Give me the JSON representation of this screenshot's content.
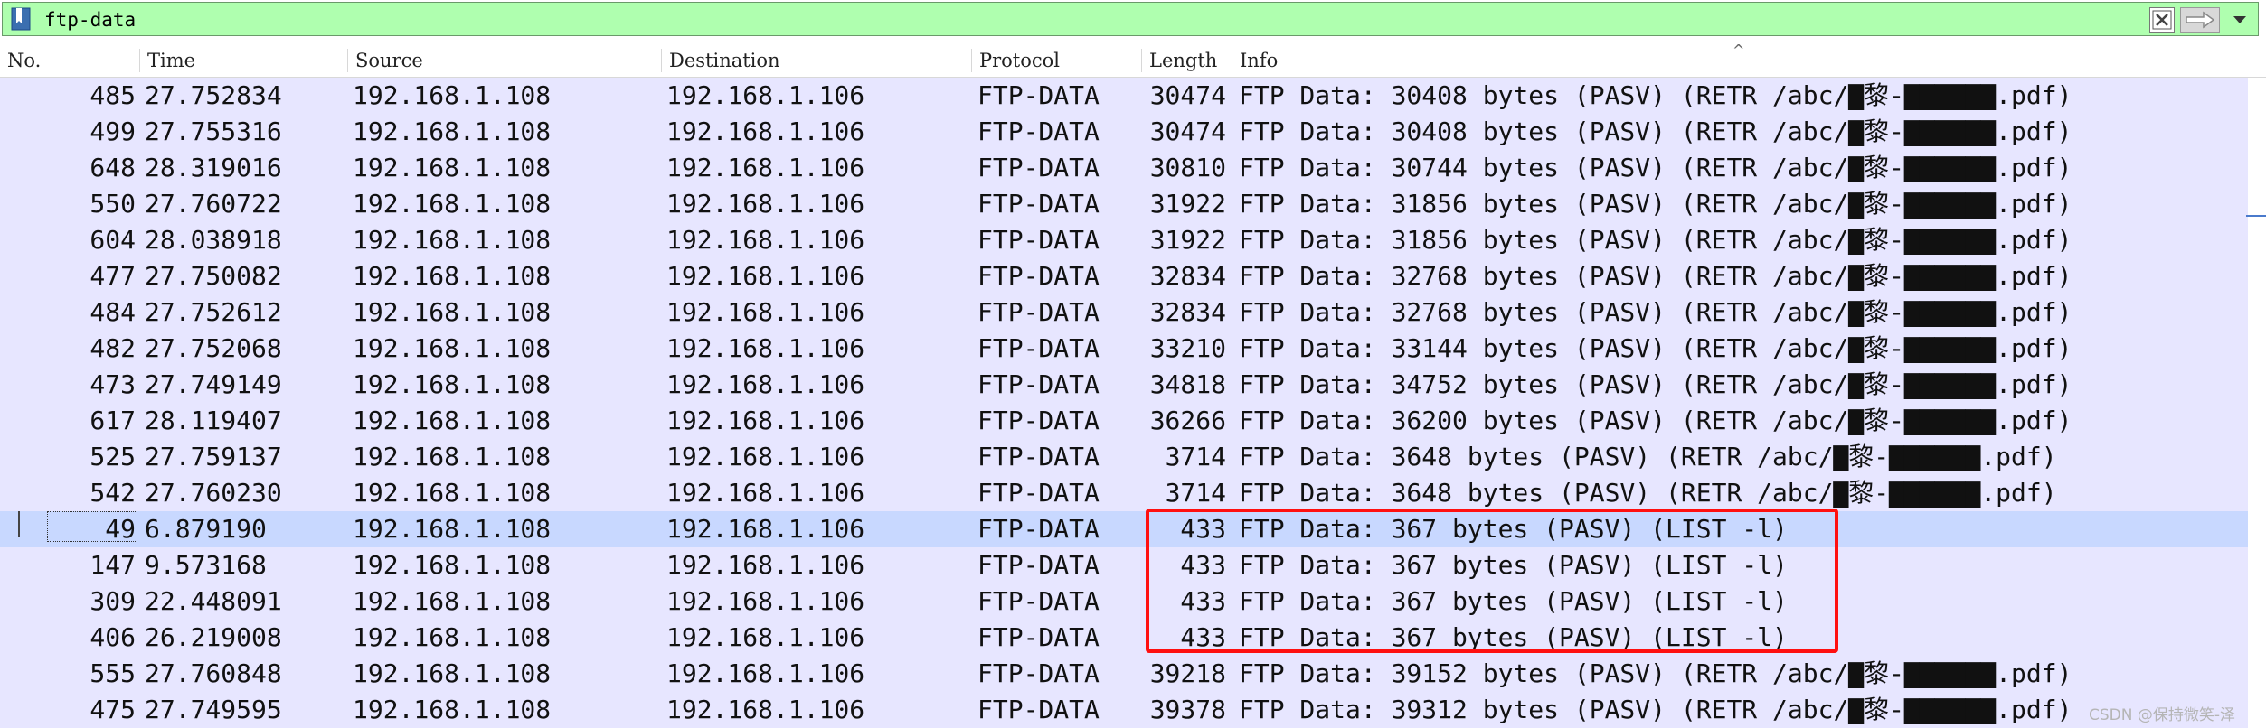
{
  "filter": {
    "value": "ftp-data",
    "bookmark_icon": "bookmark-icon",
    "clear_icon": "clear-x-icon",
    "apply_icon": "arrow-right-icon",
    "dropdown_icon": "chevron-down-icon"
  },
  "columns": {
    "no": "No.",
    "time": "Time",
    "source": "Source",
    "destination": "Destination",
    "protocol": "Protocol",
    "length": "Length",
    "info": "Info"
  },
  "packets": [
    {
      "no": "485",
      "time": "27.752834",
      "source": "192.168.1.108",
      "destination": "192.168.1.106",
      "protocol": "FTP-DATA",
      "length": "30474",
      "info": "FTP Data: 30408 bytes (PASV) (RETR /abc/▇黎-▇▇▇▇▇▇.pdf)"
    },
    {
      "no": "499",
      "time": "27.755316",
      "source": "192.168.1.108",
      "destination": "192.168.1.106",
      "protocol": "FTP-DATA",
      "length": "30474",
      "info": "FTP Data: 30408 bytes (PASV) (RETR /abc/▇黎-▇▇▇▇▇▇.pdf)"
    },
    {
      "no": "648",
      "time": "28.319016",
      "source": "192.168.1.108",
      "destination": "192.168.1.106",
      "protocol": "FTP-DATA",
      "length": "30810",
      "info": "FTP Data: 30744 bytes (PASV) (RETR /abc/▇黎-▇▇▇▇▇▇.pdf)"
    },
    {
      "no": "550",
      "time": "27.760722",
      "source": "192.168.1.108",
      "destination": "192.168.1.106",
      "protocol": "FTP-DATA",
      "length": "31922",
      "info": "FTP Data: 31856 bytes (PASV) (RETR /abc/▇黎-▇▇▇▇▇▇.pdf)"
    },
    {
      "no": "604",
      "time": "28.038918",
      "source": "192.168.1.108",
      "destination": "192.168.1.106",
      "protocol": "FTP-DATA",
      "length": "31922",
      "info": "FTP Data: 31856 bytes (PASV) (RETR /abc/▇黎-▇▇▇▇▇▇.pdf)"
    },
    {
      "no": "477",
      "time": "27.750082",
      "source": "192.168.1.108",
      "destination": "192.168.1.106",
      "protocol": "FTP-DATA",
      "length": "32834",
      "info": "FTP Data: 32768 bytes (PASV) (RETR /abc/▇黎-▇▇▇▇▇▇.pdf)"
    },
    {
      "no": "484",
      "time": "27.752612",
      "source": "192.168.1.108",
      "destination": "192.168.1.106",
      "protocol": "FTP-DATA",
      "length": "32834",
      "info": "FTP Data: 32768 bytes (PASV) (RETR /abc/▇黎-▇▇▇▇▇▇.pdf)"
    },
    {
      "no": "482",
      "time": "27.752068",
      "source": "192.168.1.108",
      "destination": "192.168.1.106",
      "protocol": "FTP-DATA",
      "length": "33210",
      "info": "FTP Data: 33144 bytes (PASV) (RETR /abc/▇黎-▇▇▇▇▇▇.pdf)"
    },
    {
      "no": "473",
      "time": "27.749149",
      "source": "192.168.1.108",
      "destination": "192.168.1.106",
      "protocol": "FTP-DATA",
      "length": "34818",
      "info": "FTP Data: 34752 bytes (PASV) (RETR /abc/▇黎-▇▇▇▇▇▇.pdf)"
    },
    {
      "no": "617",
      "time": "28.119407",
      "source": "192.168.1.108",
      "destination": "192.168.1.106",
      "protocol": "FTP-DATA",
      "length": "36266",
      "info": "FTP Data: 36200 bytes (PASV) (RETR /abc/▇黎-▇▇▇▇▇▇.pdf)"
    },
    {
      "no": "525",
      "time": "27.759137",
      "source": "192.168.1.108",
      "destination": "192.168.1.106",
      "protocol": "FTP-DATA",
      "length": "3714",
      "info": "FTP Data: 3648 bytes (PASV) (RETR /abc/▇黎-▇▇▇▇▇▇.pdf)"
    },
    {
      "no": "542",
      "time": "27.760230",
      "source": "192.168.1.108",
      "destination": "192.168.1.106",
      "protocol": "FTP-DATA",
      "length": "3714",
      "info": "FTP Data: 3648 bytes (PASV) (RETR /abc/▇黎-▇▇▇▇▇▇.pdf)"
    },
    {
      "no": "49",
      "time": "6.879190",
      "source": "192.168.1.108",
      "destination": "192.168.1.106",
      "protocol": "FTP-DATA",
      "length": "433",
      "info": "FTP Data: 367 bytes (PASV) (LIST -l)"
    },
    {
      "no": "147",
      "time": "9.573168",
      "source": "192.168.1.108",
      "destination": "192.168.1.106",
      "protocol": "FTP-DATA",
      "length": "433",
      "info": "FTP Data: 367 bytes (PASV) (LIST -l)"
    },
    {
      "no": "309",
      "time": "22.448091",
      "source": "192.168.1.108",
      "destination": "192.168.1.106",
      "protocol": "FTP-DATA",
      "length": "433",
      "info": "FTP Data: 367 bytes (PASV) (LIST -l)"
    },
    {
      "no": "406",
      "time": "26.219008",
      "source": "192.168.1.108",
      "destination": "192.168.1.106",
      "protocol": "FTP-DATA",
      "length": "433",
      "info": "FTP Data: 367 bytes (PASV) (LIST -l)"
    },
    {
      "no": "555",
      "time": "27.760848",
      "source": "192.168.1.108",
      "destination": "192.168.1.106",
      "protocol": "FTP-DATA",
      "length": "39218",
      "info": "FTP Data: 39152 bytes (PASV) (RETR /abc/▇黎-▇▇▇▇▇▇.pdf)"
    },
    {
      "no": "475",
      "time": "27.749595",
      "source": "192.168.1.108",
      "destination": "192.168.1.106",
      "protocol": "FTP-DATA",
      "length": "39378",
      "info": "FTP Data: 39312 bytes (PASV) (RETR /abc/▇黎-▇▇▇▇▇▇.pdf)"
    }
  ],
  "selected_no": "49",
  "colors": {
    "filter_valid_bg": "#afffaf",
    "row_bg": "#e7e6ff",
    "selected_row_bg": "#c8d8ff",
    "highlight_border": "#ff1010"
  },
  "watermark": "CSDN @保持微笑-泽"
}
